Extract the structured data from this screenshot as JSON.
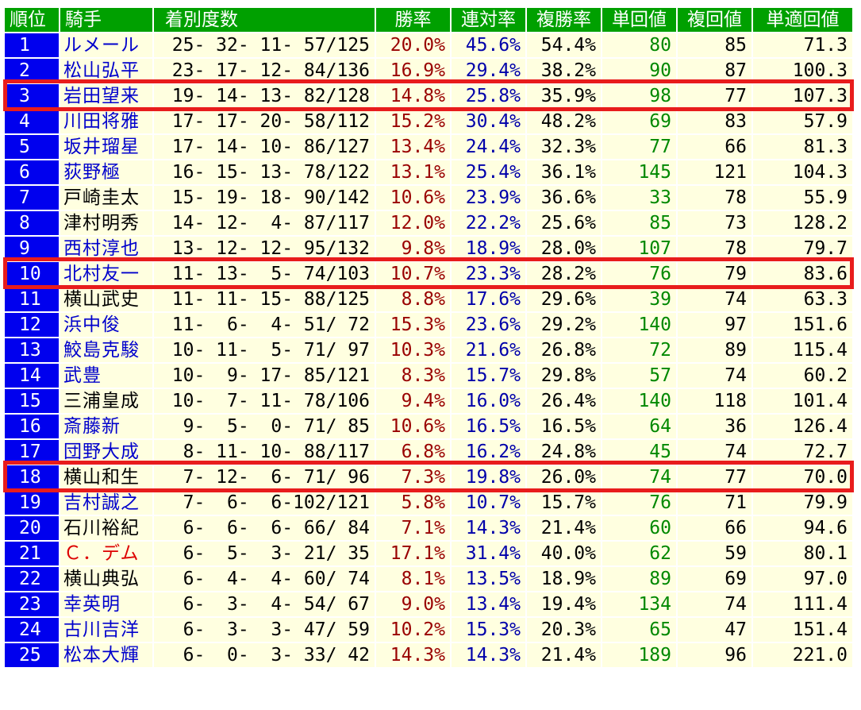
{
  "headers": {
    "rank": "順位",
    "jockey": "騎手",
    "record": "着別度数",
    "win": "勝率",
    "rentai": "連対率",
    "fukusho": "複勝率",
    "tan": "単回値",
    "fuku": "複回値",
    "tekisei": "単適回値"
  },
  "colors": {
    "header_green": "#00a000",
    "rank_blue": "#0000ee",
    "cell_bg": "#ffffe0",
    "highlight_red": "#e81c1c",
    "link_blue": "#0000cc"
  },
  "rows": [
    {
      "rank": "1",
      "name": "ルメール",
      "name_color": "link",
      "record": "25- 32- 11- 57/125",
      "win": "20.0%",
      "rentai": "45.6%",
      "fukusho": "54.4%",
      "tan": "80",
      "fuku": "85",
      "tekisei": "71.3"
    },
    {
      "rank": "2",
      "name": "松山弘平",
      "name_color": "link",
      "record": "23- 17- 12- 84/136",
      "win": "16.9%",
      "rentai": "29.4%",
      "fukusho": "38.2%",
      "tan": "90",
      "fuku": "87",
      "tekisei": "100.3"
    },
    {
      "rank": "3",
      "name": "岩田望来",
      "name_color": "link",
      "record": "19- 14- 13- 82/128",
      "win": "14.8%",
      "rentai": "25.8%",
      "fukusho": "35.9%",
      "tan": "98",
      "fuku": "77",
      "tekisei": "107.3"
    },
    {
      "rank": "4",
      "name": "川田将雅",
      "name_color": "link",
      "record": "17- 17- 20- 58/112",
      "win": "15.2%",
      "rentai": "30.4%",
      "fukusho": "48.2%",
      "tan": "69",
      "fuku": "83",
      "tekisei": "57.9"
    },
    {
      "rank": "5",
      "name": "坂井瑠星",
      "name_color": "link",
      "record": "17- 14- 10- 86/127",
      "win": "13.4%",
      "rentai": "24.4%",
      "fukusho": "32.3%",
      "tan": "77",
      "fuku": "66",
      "tekisei": "81.3"
    },
    {
      "rank": "6",
      "name": "荻野極",
      "name_color": "link",
      "record": "16- 15- 13- 78/122",
      "win": "13.1%",
      "rentai": "25.4%",
      "fukusho": "36.1%",
      "tan": "145",
      "fuku": "121",
      "tekisei": "104.3"
    },
    {
      "rank": "7",
      "name": "戸崎圭太",
      "name_color": "black",
      "record": "15- 19- 18- 90/142",
      "win": "10.6%",
      "rentai": "23.9%",
      "fukusho": "36.6%",
      "tan": "33",
      "fuku": "78",
      "tekisei": "55.9"
    },
    {
      "rank": "8",
      "name": "津村明秀",
      "name_color": "black",
      "record": "14- 12-  4- 87/117",
      "win": "12.0%",
      "rentai": "22.2%",
      "fukusho": "25.6%",
      "tan": "85",
      "fuku": "73",
      "tekisei": "128.2"
    },
    {
      "rank": "9",
      "name": "西村淳也",
      "name_color": "link",
      "record": "13- 12- 12- 95/132",
      "win": "9.8%",
      "rentai": "18.9%",
      "fukusho": "28.0%",
      "tan": "107",
      "fuku": "78",
      "tekisei": "79.7"
    },
    {
      "rank": "10",
      "name": "北村友一",
      "name_color": "link",
      "record": "11- 13-  5- 74/103",
      "win": "10.7%",
      "rentai": "23.3%",
      "fukusho": "28.2%",
      "tan": "76",
      "fuku": "79",
      "tekisei": "83.6"
    },
    {
      "rank": "11",
      "name": "横山武史",
      "name_color": "black",
      "record": "11- 11- 15- 88/125",
      "win": "8.8%",
      "rentai": "17.6%",
      "fukusho": "29.6%",
      "tan": "39",
      "fuku": "74",
      "tekisei": "63.3"
    },
    {
      "rank": "12",
      "name": "浜中俊",
      "name_color": "link",
      "record": "11-  6-  4- 51/ 72",
      "win": "15.3%",
      "rentai": "23.6%",
      "fukusho": "29.2%",
      "tan": "140",
      "fuku": "97",
      "tekisei": "151.6"
    },
    {
      "rank": "13",
      "name": "鮫島克駿",
      "name_color": "link",
      "record": "10- 11-  5- 71/ 97",
      "win": "10.3%",
      "rentai": "21.6%",
      "fukusho": "26.8%",
      "tan": "72",
      "fuku": "89",
      "tekisei": "115.4"
    },
    {
      "rank": "14",
      "name": "武豊",
      "name_color": "link",
      "record": "10-  9- 17- 85/121",
      "win": "8.3%",
      "rentai": "15.7%",
      "fukusho": "29.8%",
      "tan": "57",
      "fuku": "74",
      "tekisei": "60.2"
    },
    {
      "rank": "15",
      "name": "三浦皇成",
      "name_color": "black",
      "record": "10-  7- 11- 78/106",
      "win": "9.4%",
      "rentai": "16.0%",
      "fukusho": "26.4%",
      "tan": "140",
      "fuku": "118",
      "tekisei": "101.4"
    },
    {
      "rank": "16",
      "name": "斎藤新",
      "name_color": "link",
      "record": " 9-  5-  0- 71/ 85",
      "win": "10.6%",
      "rentai": "16.5%",
      "fukusho": "16.5%",
      "tan": "64",
      "fuku": "36",
      "tekisei": "126.4"
    },
    {
      "rank": "17",
      "name": "団野大成",
      "name_color": "link",
      "record": " 8- 11- 10- 88/117",
      "win": "6.8%",
      "rentai": "16.2%",
      "fukusho": "24.8%",
      "tan": "45",
      "fuku": "74",
      "tekisei": "72.7"
    },
    {
      "rank": "18",
      "name": "横山和生",
      "name_color": "black",
      "record": " 7- 12-  6- 71/ 96",
      "win": "7.3%",
      "rentai": "19.8%",
      "fukusho": "26.0%",
      "tan": "74",
      "fuku": "77",
      "tekisei": "70.0"
    },
    {
      "rank": "19",
      "name": "吉村誠之",
      "name_color": "link",
      "record": " 7-  6-  6-102/121",
      "win": "5.8%",
      "rentai": "10.7%",
      "fukusho": "15.7%",
      "tan": "76",
      "fuku": "71",
      "tekisei": "79.9"
    },
    {
      "rank": "20",
      "name": "石川裕紀",
      "name_color": "black",
      "record": " 6-  6-  6- 66/ 84",
      "win": "7.1%",
      "rentai": "14.3%",
      "fukusho": "21.4%",
      "tan": "60",
      "fuku": "66",
      "tekisei": "94.6"
    },
    {
      "rank": "21",
      "name": "Ｃ．デム",
      "name_color": "red",
      "record": " 6-  5-  3- 21/ 35",
      "win": "17.1%",
      "rentai": "31.4%",
      "fukusho": "40.0%",
      "tan": "62",
      "fuku": "59",
      "tekisei": "80.1"
    },
    {
      "rank": "22",
      "name": "横山典弘",
      "name_color": "black",
      "record": " 6-  4-  4- 60/ 74",
      "win": "8.1%",
      "rentai": "13.5%",
      "fukusho": "18.9%",
      "tan": "89",
      "fuku": "69",
      "tekisei": "97.0"
    },
    {
      "rank": "23",
      "name": "幸英明",
      "name_color": "link",
      "record": " 6-  3-  4- 54/ 67",
      "win": "9.0%",
      "rentai": "13.4%",
      "fukusho": "19.4%",
      "tan": "134",
      "fuku": "74",
      "tekisei": "111.4"
    },
    {
      "rank": "24",
      "name": "古川吉洋",
      "name_color": "link",
      "record": " 6-  3-  3- 47/ 59",
      "win": "10.2%",
      "rentai": "15.3%",
      "fukusho": "20.3%",
      "tan": "65",
      "fuku": "47",
      "tekisei": "151.4"
    },
    {
      "rank": "25",
      "name": "松本大輝",
      "name_color": "link",
      "record": " 6-  0-  3- 33/ 42",
      "win": "14.3%",
      "rentai": "14.3%",
      "fukusho": "21.4%",
      "tan": "189",
      "fuku": "96",
      "tekisei": "221.0"
    }
  ],
  "highlighted_rows": [
    "3",
    "10",
    "18"
  ]
}
